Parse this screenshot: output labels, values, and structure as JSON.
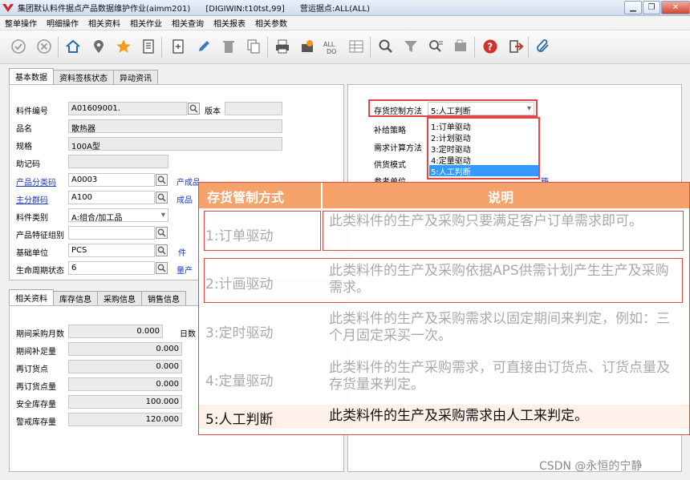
{
  "window": {
    "title": "集团默认料件据点产品数据维护作业(aimm201)      [DIGIWIN:t10tst,99]      营运据点:ALL(ALL)"
  },
  "menu": [
    "整单操作",
    "明细操作",
    "相关资料",
    "相关作业",
    "相关查询",
    "相关报表",
    "相关参数"
  ],
  "toolbar": {
    "icons": [
      "confirm-icon",
      "void-icon",
      "home-icon",
      "location-icon",
      "favorite-icon",
      "list-icon",
      "add-icon",
      "edit-icon",
      "delete-icon",
      "copy-icon",
      "print-icon",
      "export-icon",
      "batch-icon",
      "grid-icon",
      "query-icon",
      "filter-icon",
      "find-icon",
      "window-icon",
      "help-icon",
      "exit-icon",
      "attach-icon"
    ]
  },
  "top_tabs": [
    "基本数据",
    "资料签核状态",
    "异动资讯"
  ],
  "fields": {
    "item_no": {
      "label": "料件编号",
      "value": "A01609001."
    },
    "version": {
      "label": "版本",
      "value": ""
    },
    "name": {
      "label": "品名",
      "value": "散热器"
    },
    "spec": {
      "label": "规格",
      "value": "100A型"
    },
    "mnemonic": {
      "label": "助记码",
      "value": ""
    },
    "category": {
      "label": "产品分类码",
      "value": "A0003",
      "side": "产成品"
    },
    "group": {
      "label": "主分群码",
      "value": "A100",
      "side": "成品"
    },
    "item_type": {
      "label": "料件类别",
      "value": "A:组合/加工品"
    },
    "feature_group": {
      "label": "产品特征组别",
      "value": ""
    },
    "base_unit": {
      "label": "基础单位",
      "value": "PCS",
      "side": "件"
    },
    "lifecycle": {
      "label": "生命周期状态",
      "value": "6",
      "side": "量产"
    }
  },
  "right": {
    "stock_method_label": "存货控制方法",
    "stock_method_value": "5:人工判断",
    "labels": [
      "补给策略",
      "需求计算方法",
      "供货模式",
      "参考单位"
    ],
    "options": [
      "1:订单驱动",
      "2:计划驱动",
      "3:定时驱动",
      "4:定量驱动",
      "5:人工判断"
    ],
    "partial": "箱"
  },
  "bottom_tabs": [
    "相关资料",
    "库存信息",
    "采购信息",
    "销售信息"
  ],
  "bottom_fields": [
    {
      "label": "期间采购月数",
      "value": "0.000",
      "unit": "日数"
    },
    {
      "label": "期间补足量",
      "value": "0.000"
    },
    {
      "label": "再订货点",
      "value": "0.000"
    },
    {
      "label": "再订货点量",
      "value": "0.000"
    },
    {
      "label": "安全库存量",
      "value": "100.000"
    },
    {
      "label": "警戒库存量",
      "value": "120.000"
    }
  ],
  "overlay": {
    "header": [
      "存货管制方式",
      "说明"
    ],
    "rows": [
      {
        "mode": "1:订单驱动",
        "desc": "此类料件的生产及采购只要满足客户订单需求即可。"
      },
      {
        "mode": "2:计画驱动",
        "desc": "此类料件的生产及采购依据APS供需计划产生生产及采购需求。"
      },
      {
        "mode": "3:定时驱动",
        "desc": "此类料件的生产及采购需求以固定期间来判定，例如：三个月固定采买一次。"
      },
      {
        "mode": "4:定量驱动",
        "desc": "此类料件的生产采购需求，可直接由订货点、订货点量及存货量来判定。"
      },
      {
        "mode": "5:人工判断",
        "desc": "此类料件的生产及采购需求由人工来判定。"
      }
    ]
  },
  "watermark": "CSDN @永恒的宁静"
}
